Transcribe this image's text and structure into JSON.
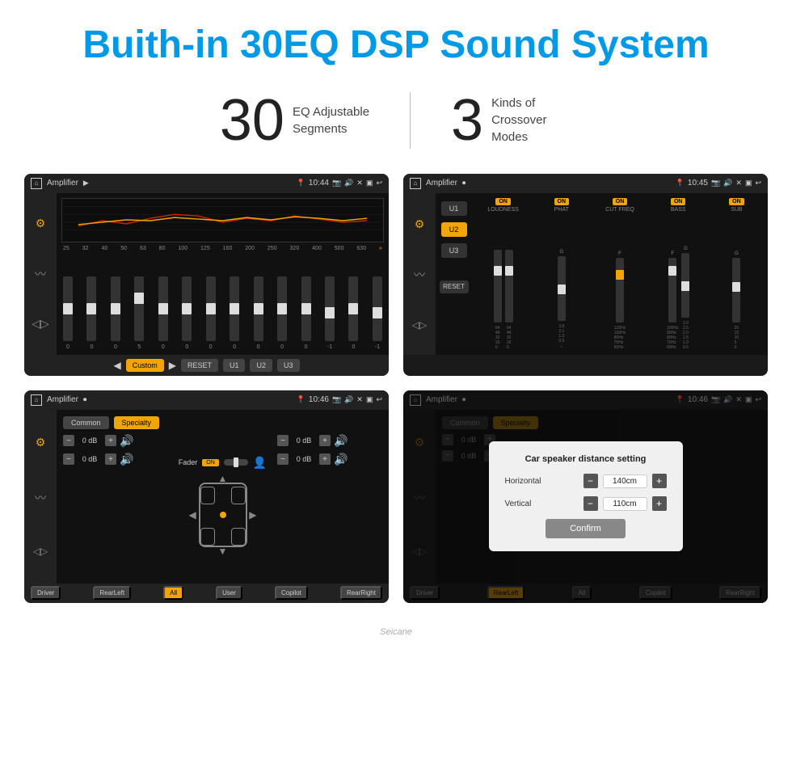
{
  "header": {
    "title": "Buith-in 30EQ DSP Sound System"
  },
  "stats": [
    {
      "number": "30",
      "label": "EQ Adjustable\nSegments"
    },
    {
      "number": "3",
      "label": "Kinds of\nCrossover Modes"
    }
  ],
  "screens": {
    "eq": {
      "topbar": {
        "title": "Amplifier",
        "time": "10:44"
      },
      "frequencies": [
        "25",
        "32",
        "40",
        "50",
        "63",
        "80",
        "100",
        "125",
        "160",
        "200",
        "250",
        "320",
        "400",
        "500",
        "630"
      ],
      "values": [
        "0",
        "0",
        "0",
        "0",
        "5",
        "0",
        "0",
        "0",
        "0",
        "0",
        "0",
        "0",
        "-1",
        "0",
        "-1"
      ],
      "bottom_buttons": [
        "Custom",
        "RESET",
        "U1",
        "U2",
        "U3"
      ]
    },
    "crossover": {
      "topbar": {
        "title": "Amplifier",
        "time": "10:45"
      },
      "presets": [
        "U1",
        "U2",
        "U3"
      ],
      "channels": [
        "LOUDNESS",
        "PHAT",
        "CUT FREQ",
        "BASS",
        "SUB"
      ]
    },
    "specialty": {
      "topbar": {
        "title": "Amplifier",
        "time": "10:46"
      },
      "tabs": [
        "Common",
        "Specialty"
      ],
      "fader_label": "Fader",
      "fader_on": "ON",
      "vol_rows": [
        {
          "label": "0 dB"
        },
        {
          "label": "0 dB"
        },
        {
          "label": "0 dB"
        },
        {
          "label": "0 dB"
        }
      ],
      "bottom_buttons": [
        "Driver",
        "RearLeft",
        "All",
        "User",
        "Copilot",
        "RearRight"
      ]
    },
    "dialog": {
      "topbar": {
        "title": "Amplifier",
        "time": "10:46"
      },
      "tabs": [
        "Common",
        "Specialty"
      ],
      "dialog": {
        "title": "Car speaker distance setting",
        "horizontal_label": "Horizontal",
        "horizontal_value": "140cm",
        "vertical_label": "Vertical",
        "vertical_value": "110cm",
        "confirm_label": "Confirm"
      },
      "bottom_buttons": [
        "Driver",
        "RearLeft",
        "All",
        "Copilot",
        "RearRight"
      ]
    }
  },
  "watermark": "Seicane"
}
